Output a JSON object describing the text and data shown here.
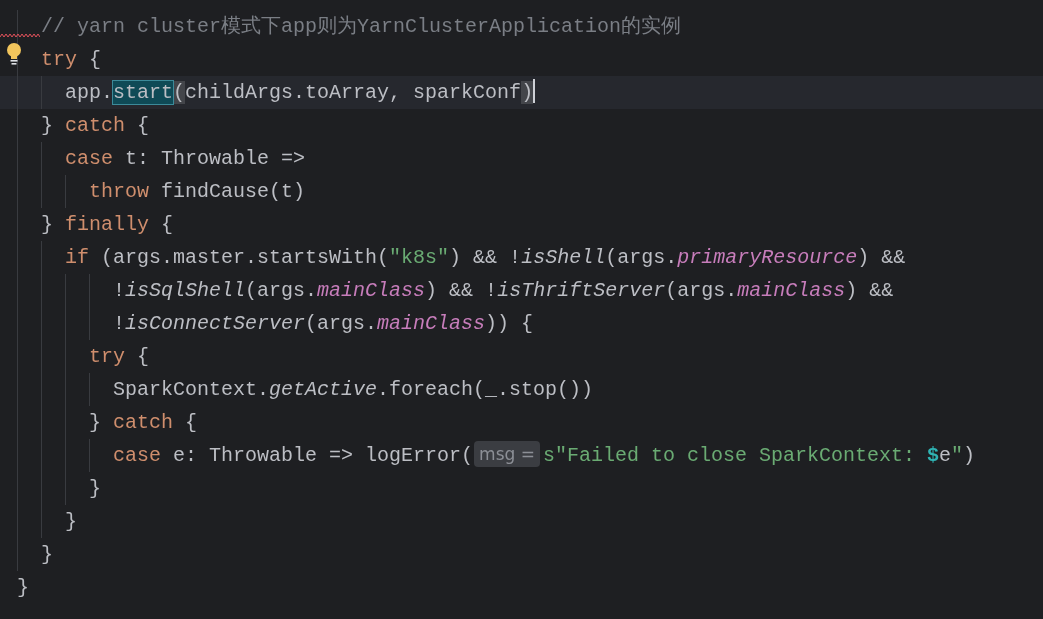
{
  "editor": {
    "lines": [
      {
        "current": false,
        "tokens": [
          {
            "kind": "comment",
            "text": "  // yarn cluster模式下app则为YarnClusterApplication的实例"
          }
        ]
      },
      {
        "current": false,
        "tokens": [
          {
            "kind": "keyword",
            "text": "  try"
          },
          {
            "kind": "plain",
            "text": " {"
          }
        ]
      },
      {
        "current": true,
        "tokens": [
          {
            "kind": "plain",
            "text": "    app."
          },
          {
            "kind": "selected",
            "text": "start"
          },
          {
            "kind": "brace",
            "text": "("
          },
          {
            "kind": "plain",
            "text": "childArgs.toArray, sparkConf"
          },
          {
            "kind": "brace",
            "text": ")"
          }
        ]
      },
      {
        "current": false,
        "tokens": [
          {
            "kind": "plain",
            "text": "  } "
          },
          {
            "kind": "keyword",
            "text": "catch"
          },
          {
            "kind": "plain",
            "text": " {"
          }
        ]
      },
      {
        "current": false,
        "tokens": [
          {
            "kind": "keyword",
            "text": "    case"
          },
          {
            "kind": "plain",
            "text": " t: Throwable =>"
          }
        ]
      },
      {
        "current": false,
        "tokens": [
          {
            "kind": "keyword",
            "text": "      throw"
          },
          {
            "kind": "plain",
            "text": " findCause(t)"
          }
        ]
      },
      {
        "current": false,
        "tokens": [
          {
            "kind": "plain",
            "text": "  } "
          },
          {
            "kind": "keyword",
            "text": "finally"
          },
          {
            "kind": "plain",
            "text": " {"
          }
        ]
      },
      {
        "current": false,
        "tokens": [
          {
            "kind": "keyword",
            "text": "    if"
          },
          {
            "kind": "plain",
            "text": " (args.master.startsWith("
          },
          {
            "kind": "string",
            "text": "\"k8s\""
          },
          {
            "kind": "plain",
            "text": ") && !"
          },
          {
            "kind": "italic",
            "text": "isShell"
          },
          {
            "kind": "plain",
            "text": "(args."
          },
          {
            "kind": "field",
            "text": "primaryResource"
          },
          {
            "kind": "plain",
            "text": ") &&"
          }
        ]
      },
      {
        "current": false,
        "tokens": [
          {
            "kind": "plain",
            "text": "        !"
          },
          {
            "kind": "italic",
            "text": "isSqlShell"
          },
          {
            "kind": "plain",
            "text": "(args."
          },
          {
            "kind": "field",
            "text": "mainClass"
          },
          {
            "kind": "plain",
            "text": ") && !"
          },
          {
            "kind": "italic",
            "text": "isThriftServer"
          },
          {
            "kind": "plain",
            "text": "(args."
          },
          {
            "kind": "field",
            "text": "mainClass"
          },
          {
            "kind": "plain",
            "text": ") &&"
          }
        ]
      },
      {
        "current": false,
        "tokens": [
          {
            "kind": "plain",
            "text": "        !"
          },
          {
            "kind": "italic",
            "text": "isConnectServer"
          },
          {
            "kind": "plain",
            "text": "(args."
          },
          {
            "kind": "field",
            "text": "mainClass"
          },
          {
            "kind": "plain",
            "text": ")) {"
          }
        ]
      },
      {
        "current": false,
        "tokens": [
          {
            "kind": "keyword",
            "text": "      try"
          },
          {
            "kind": "plain",
            "text": " {"
          }
        ]
      },
      {
        "current": false,
        "tokens": [
          {
            "kind": "plain",
            "text": "        SparkContext."
          },
          {
            "kind": "italic",
            "text": "getActive"
          },
          {
            "kind": "plain",
            "text": ".foreach(_.stop())"
          }
        ]
      },
      {
        "current": false,
        "tokens": [
          {
            "kind": "plain",
            "text": "      } "
          },
          {
            "kind": "keyword",
            "text": "catch"
          },
          {
            "kind": "plain",
            "text": " {"
          }
        ]
      },
      {
        "current": false,
        "tokens": [
          {
            "kind": "keyword",
            "text": "        case"
          },
          {
            "kind": "plain",
            "text": " e: Throwable => logError("
          },
          {
            "kind": "hint",
            "text": "msg ="
          },
          {
            "kind": "string",
            "text": "s\"Failed to close SparkContext: "
          },
          {
            "kind": "interp",
            "text": "$"
          },
          {
            "kind": "plain",
            "text": "e"
          },
          {
            "kind": "string",
            "text": "\""
          },
          {
            "kind": "plain",
            "text": ")"
          }
        ]
      },
      {
        "current": false,
        "tokens": [
          {
            "kind": "plain",
            "text": "      }"
          }
        ]
      },
      {
        "current": false,
        "tokens": [
          {
            "kind": "plain",
            "text": "    }"
          }
        ]
      },
      {
        "current": false,
        "tokens": [
          {
            "kind": "plain",
            "text": "  }"
          }
        ]
      },
      {
        "current": false,
        "tokens": [
          {
            "kind": "plain",
            "text": "}"
          }
        ]
      }
    ]
  }
}
